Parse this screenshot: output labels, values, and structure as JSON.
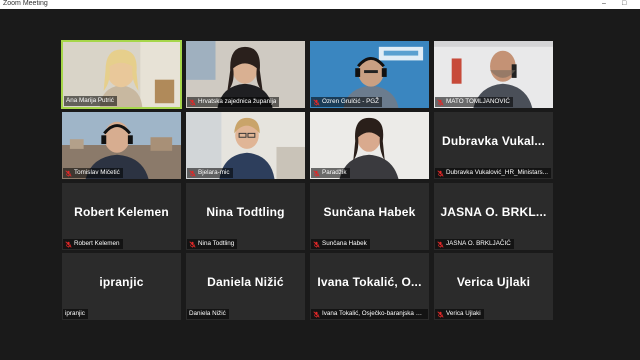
{
  "window": {
    "title": "Zoom Meeting",
    "controls": [
      "–",
      "□"
    ]
  },
  "colors": {
    "active_speaker_border": "#a6d64a",
    "muted_icon": "#e02828",
    "tile_bg": "#2b2b2b",
    "background": "#1a1a1a"
  },
  "participants": [
    {
      "label": "Ana Marija Putrić",
      "video": true,
      "muted": false,
      "active": true
    },
    {
      "label": "Hrvatska zajednica županija",
      "video": true,
      "muted": true
    },
    {
      "label": "Ozren Grulčić - PGŽ",
      "video": true,
      "muted": true
    },
    {
      "label": "MATO TOMLJANOVIĆ",
      "video": true,
      "muted": true
    },
    {
      "label": "Tomislav Mičetić",
      "video": true,
      "muted": true
    },
    {
      "label": "Bjelara-mic",
      "video": true,
      "muted": true
    },
    {
      "label": "Paradžik",
      "video": true,
      "muted": true
    },
    {
      "display_name": "Dubravka  Vukal...",
      "label": "Dubravka Vukalović_HR_Ministars...",
      "video": false,
      "muted": true
    },
    {
      "display_name": "Robert Kelemen",
      "label": "Robert Kelemen",
      "video": false,
      "muted": true
    },
    {
      "display_name": "Nina Todtling",
      "label": "Nina Todtling",
      "video": false,
      "muted": true
    },
    {
      "display_name": "Sunčana Habek",
      "label": "Sunčana Habek",
      "video": false,
      "muted": true
    },
    {
      "display_name": "JASNA  O.  BRKL...",
      "label": "JASNA  O. BRKLJAČIĆ",
      "video": false,
      "muted": true
    },
    {
      "display_name": "ipranjic",
      "label": "ipranjic",
      "video": false,
      "muted": false
    },
    {
      "display_name": "Daniela Nižić",
      "label": "Daniela Nižić",
      "video": false,
      "muted": false
    },
    {
      "display_name": "Ivana  Tokalić,  O...",
      "label": "Ivana Tokalić, Osječko-baranjska žup...",
      "video": false,
      "muted": true
    },
    {
      "display_name": "Verica Ujlaki",
      "label": "Verica Ujlaki",
      "video": false,
      "muted": true
    }
  ]
}
